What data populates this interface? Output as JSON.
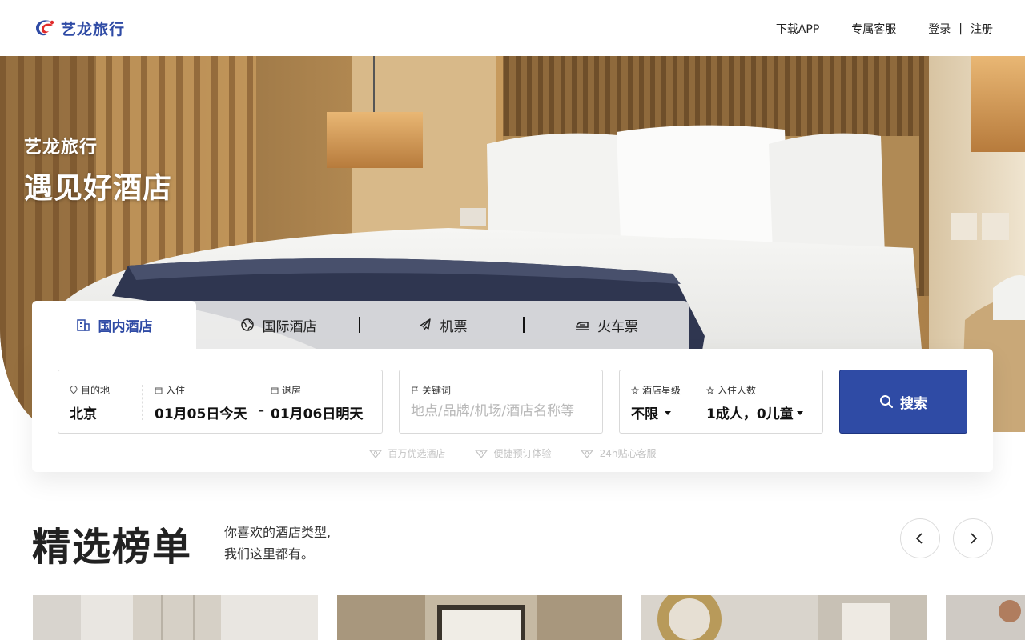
{
  "header": {
    "logo_text": "艺龙旅行",
    "nav": {
      "download_app": "下载APP",
      "service": "专属客服",
      "login": "登录",
      "separator": "|",
      "register": "注册"
    }
  },
  "hero": {
    "brand": "艺龙旅行",
    "slogan": "遇见好酒店"
  },
  "tabs": [
    {
      "label": "国内酒店",
      "icon": "building-icon",
      "active": true
    },
    {
      "label": "国际酒店",
      "icon": "globe-icon",
      "active": false
    },
    {
      "label": "机票",
      "icon": "plane-icon",
      "active": false
    },
    {
      "label": "火车票",
      "icon": "train-icon",
      "active": false
    }
  ],
  "search": {
    "destination": {
      "label": "目的地",
      "value": "北京"
    },
    "checkin": {
      "label": "入住",
      "value": "01月05日今天"
    },
    "date_separator": "-",
    "checkout": {
      "label": "退房",
      "value": "01月06日明天"
    },
    "keyword": {
      "label": "关键词",
      "value": "",
      "placeholder": "地点/品牌/机场/酒店名称等"
    },
    "star": {
      "label": "酒店星级",
      "value": "不限"
    },
    "guests": {
      "label": "入住人数",
      "value": "1成人，0儿童"
    },
    "button_label": "搜索"
  },
  "features": [
    "百万优选酒店",
    "便捷预订体验",
    "24h贴心客服"
  ],
  "section": {
    "title": "精选榜单",
    "subtitle_line1": "你喜欢的酒店类型,",
    "subtitle_line2": "我们这里都有。"
  },
  "colors": {
    "brand_blue": "#2f4ba5",
    "logo_red": "#e02b2b"
  }
}
